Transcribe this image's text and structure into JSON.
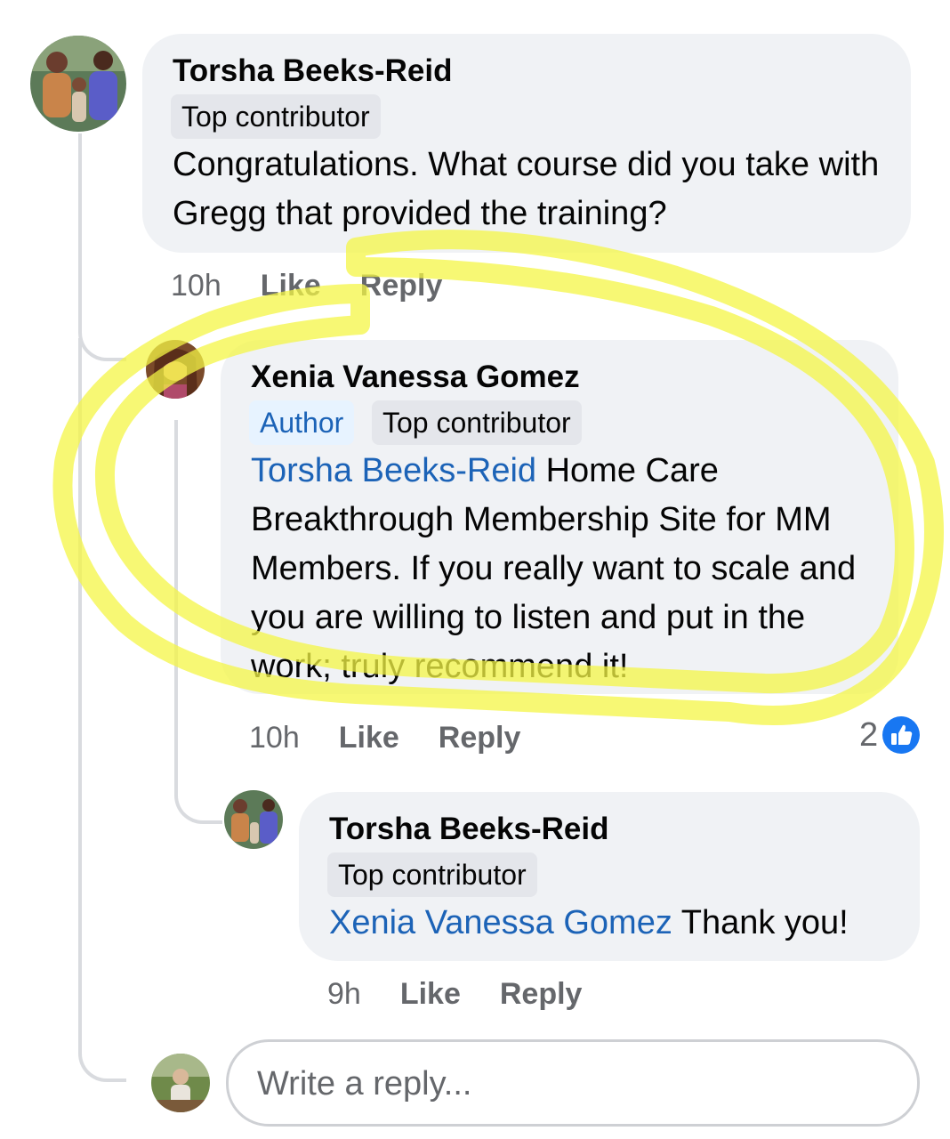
{
  "comment1": {
    "author": "Torsha Beeks-Reid",
    "badge": "Top contributor",
    "text": "Congratulations. What course did you take with Gregg that provided the training?",
    "time": "10h",
    "like_label": "Like",
    "reply_label": "Reply"
  },
  "comment2": {
    "author": "Xenia Vanessa Gomez",
    "author_badge": "Author",
    "badge": "Top contributor",
    "mention": "Torsha Beeks-Reid",
    "text": "Home Care Breakthrough Membership Site for MM Members. If you really want to scale and you are willing to listen and put in the work; truly recommend it!",
    "time": "10h",
    "like_label": "Like",
    "reply_label": "Reply",
    "reaction_count": "2"
  },
  "comment3": {
    "author": "Torsha Beeks-Reid",
    "badge": "Top contributor",
    "mention": "Xenia Vanessa Gomez",
    "text": "Thank you!",
    "time": "9h",
    "like_label": "Like",
    "reply_label": "Reply"
  },
  "reply_input": {
    "placeholder": "Write a reply..."
  },
  "colors": {
    "bubble": "#f0f2f5",
    "mention": "#1c63b7",
    "like_blue": "#1877f2",
    "highlight": "#f4f545"
  },
  "icons": {
    "reaction": "thumbs-up-icon"
  }
}
